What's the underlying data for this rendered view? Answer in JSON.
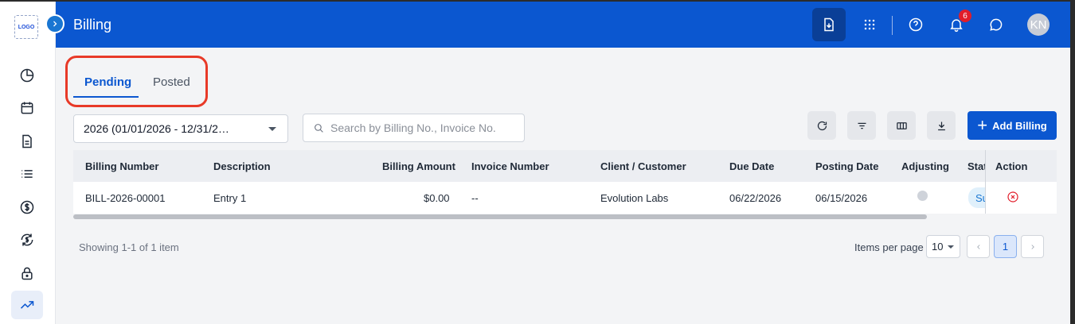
{
  "app": {
    "logo_text": "LOGO",
    "page_title": "Billing"
  },
  "sidebar": {
    "items": [
      {
        "name": "dashboard-pie-icon"
      },
      {
        "name": "calendar-icon"
      },
      {
        "name": "document-icon"
      },
      {
        "name": "list-icon"
      },
      {
        "name": "dollar-circle-icon"
      },
      {
        "name": "dollar-sync-icon"
      },
      {
        "name": "lock-icon"
      },
      {
        "name": "trending-up-icon",
        "active": true
      }
    ]
  },
  "header": {
    "notifications_count": "6",
    "avatar_initials": "KN",
    "icons": [
      "download-document-icon",
      "apps-grid-icon",
      "help-icon",
      "bell-icon",
      "chat-icon"
    ]
  },
  "tabs": [
    {
      "label": "Pending",
      "active": true
    },
    {
      "label": "Posted",
      "active": false
    }
  ],
  "filters": {
    "year_value": "2026 (01/01/2026 - 12/31/2…",
    "search_placeholder": "Search by Billing No., Invoice No."
  },
  "toolbar": {
    "add_label": "Add Billing"
  },
  "table": {
    "columns": [
      "Billing Number",
      "Description",
      "Billing Amount",
      "Invoice Number",
      "Client / Customer",
      "Due Date",
      "Posting Date",
      "Adjusting",
      "Stat",
      "Action"
    ],
    "rows": [
      {
        "billing_number": "BILL-2026-00001",
        "description": "Entry 1",
        "billing_amount": "$0.00",
        "invoice_number": "--",
        "client": "Evolution Labs",
        "due_date": "06/22/2026",
        "posting_date": "06/15/2026",
        "status": "Su"
      }
    ]
  },
  "footer": {
    "showing": "Showing 1-1 of 1 item",
    "items_per_page_label": "Items per page",
    "items_per_page": "10",
    "current_page": "1"
  },
  "colors": {
    "primary": "#0b57d0",
    "danger": "#e11d2a",
    "highlight": "#e83a28"
  }
}
